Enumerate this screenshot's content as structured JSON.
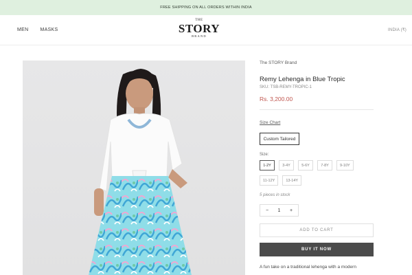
{
  "announcement": {
    "text": "FREE SHIPPING ON ALL ORDERS WITHIN INDIA"
  },
  "header": {
    "nav": [
      {
        "label": "MEN"
      },
      {
        "label": "MASKS"
      }
    ],
    "logo": {
      "top": "THE",
      "main": "STORY",
      "bottom": "BRAND"
    },
    "locale": "INDIA (₹)"
  },
  "product": {
    "vendor": "The STORY Brand",
    "title": "Remy Lehenga in Blue Tropic",
    "sku": "SKU: TSB-REMY-TROPIC-1",
    "price": "Rs. 3,200.00",
    "size_chart_label": "Size Chart",
    "style_option": "Custom Tailored",
    "size_label": "Size:",
    "sizes": [
      {
        "label": "1-2Y",
        "selected": true
      },
      {
        "label": "3-4Y"
      },
      {
        "label": "5-6Y"
      },
      {
        "label": "7-8Y"
      },
      {
        "label": "9-10Y"
      },
      {
        "label": "11-12Y"
      },
      {
        "label": "13-14Y"
      }
    ],
    "stock": "5 pieces in stock",
    "quantity": {
      "value": "1",
      "minus": "−",
      "plus": "+"
    },
    "add_to_cart": "ADD TO CART",
    "buy_now": "BUY IT NOW",
    "description_start": "A fun take on a traditional lehenga with a modern"
  },
  "colors": {
    "announcement_bg": "#dff0df",
    "price": "#c0564f",
    "buy_button": "#4b4b4b"
  }
}
